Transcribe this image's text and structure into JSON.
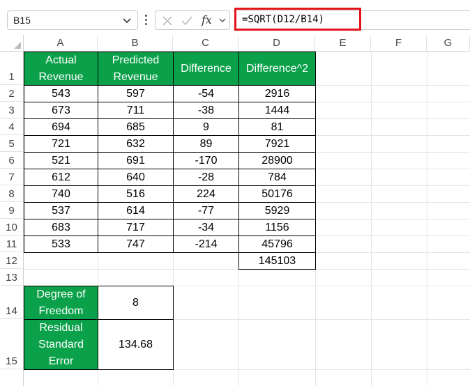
{
  "name_box": {
    "value": "B15"
  },
  "formula_bar": {
    "fx_label": "fx",
    "formula": "=SQRT(D12/B14)"
  },
  "columns": [
    "A",
    "B",
    "C",
    "D",
    "E",
    "F",
    "G"
  ],
  "rows": [
    "1",
    "2",
    "3",
    "4",
    "5",
    "6",
    "7",
    "8",
    "9",
    "10",
    "11",
    "12",
    "13",
    "14",
    "15"
  ],
  "table": {
    "headers": [
      {
        "line1": "Actual",
        "line2": "Revenue"
      },
      {
        "line1": "Predicted",
        "line2": "Revenue"
      },
      {
        "line1": "Difference",
        "line2": ""
      },
      {
        "line1": "Difference^2",
        "line2": ""
      }
    ],
    "data": [
      [
        "543",
        "597",
        "-54",
        "2916"
      ],
      [
        "673",
        "711",
        "-38",
        "1444"
      ],
      [
        "694",
        "685",
        "9",
        "81"
      ],
      [
        "721",
        "632",
        "89",
        "7921"
      ],
      [
        "521",
        "691",
        "-170",
        "28900"
      ],
      [
        "612",
        "640",
        "-28",
        "784"
      ],
      [
        "740",
        "516",
        "224",
        "50176"
      ],
      [
        "537",
        "614",
        "-77",
        "5929"
      ],
      [
        "683",
        "717",
        "-34",
        "1156"
      ],
      [
        "533",
        "747",
        "-214",
        "45796"
      ]
    ],
    "total": "145103"
  },
  "summary": {
    "dof_label": {
      "line1": "Degree of",
      "line2": "Freedom"
    },
    "dof_value": "8",
    "rse_label": {
      "line1": "Residual",
      "line2": "Standard",
      "line3": "Error"
    },
    "rse_value": "134.68"
  },
  "colors": {
    "header_fill": "#0aa14a",
    "highlight": "#e3141c"
  }
}
